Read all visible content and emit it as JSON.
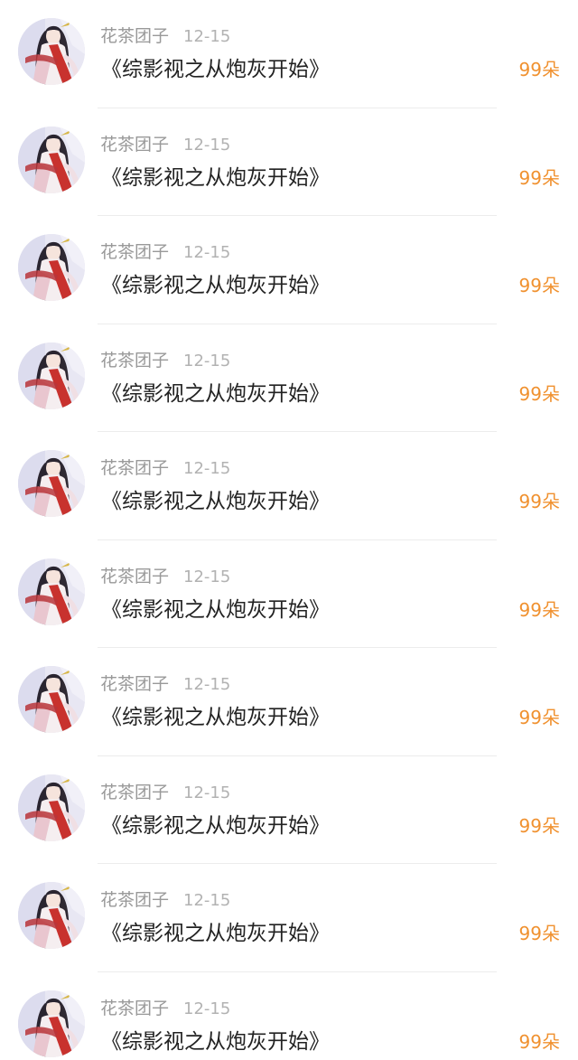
{
  "colors": {
    "accent": "#f0912f",
    "name": "#999999",
    "date": "#b2b2b2",
    "title": "#222222"
  },
  "items": [
    {
      "avatar_icon": "user-avatar-icon",
      "name": "花茶团子",
      "date": "12-15",
      "title": "《综影视之从炮灰开始》",
      "count": "99朵"
    },
    {
      "avatar_icon": "user-avatar-icon",
      "name": "花茶团子",
      "date": "12-15",
      "title": "《综影视之从炮灰开始》",
      "count": "99朵"
    },
    {
      "avatar_icon": "user-avatar-icon",
      "name": "花茶团子",
      "date": "12-15",
      "title": "《综影视之从炮灰开始》",
      "count": "99朵"
    },
    {
      "avatar_icon": "user-avatar-icon",
      "name": "花茶团子",
      "date": "12-15",
      "title": "《综影视之从炮灰开始》",
      "count": "99朵"
    },
    {
      "avatar_icon": "user-avatar-icon",
      "name": "花茶团子",
      "date": "12-15",
      "title": "《综影视之从炮灰开始》",
      "count": "99朵"
    },
    {
      "avatar_icon": "user-avatar-icon",
      "name": "花茶团子",
      "date": "12-15",
      "title": "《综影视之从炮灰开始》",
      "count": "99朵"
    },
    {
      "avatar_icon": "user-avatar-icon",
      "name": "花茶团子",
      "date": "12-15",
      "title": "《综影视之从炮灰开始》",
      "count": "99朵"
    },
    {
      "avatar_icon": "user-avatar-icon",
      "name": "花茶团子",
      "date": "12-15",
      "title": "《综影视之从炮灰开始》",
      "count": "99朵"
    },
    {
      "avatar_icon": "user-avatar-icon",
      "name": "花茶团子",
      "date": "12-15",
      "title": "《综影视之从炮灰开始》",
      "count": "99朵"
    },
    {
      "avatar_icon": "user-avatar-icon",
      "name": "花茶团子",
      "date": "12-15",
      "title": "《综影视之从炮灰开始》",
      "count": "99朵"
    }
  ]
}
